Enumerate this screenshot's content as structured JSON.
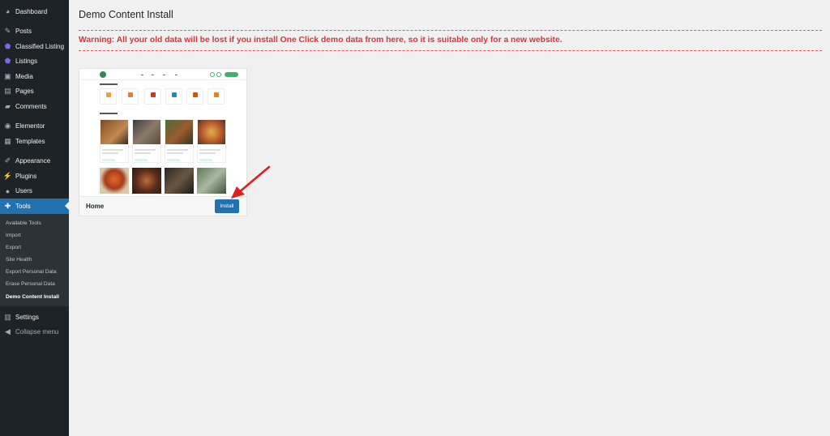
{
  "sidebar": {
    "items": [
      {
        "label": "Dashboard",
        "icon": "dashboard-icon"
      },
      {
        "label": "Posts",
        "icon": "pin-icon"
      },
      {
        "label": "Classified Listing",
        "icon": "shield-icon"
      },
      {
        "label": "Listings",
        "icon": "shield-icon"
      },
      {
        "label": "Media",
        "icon": "media-icon"
      },
      {
        "label": "Pages",
        "icon": "pages-icon"
      },
      {
        "label": "Comments",
        "icon": "comment-icon"
      },
      {
        "label": "Elementor",
        "icon": "elementor-icon"
      },
      {
        "label": "Templates",
        "icon": "templates-icon"
      },
      {
        "label": "Appearance",
        "icon": "brush-icon"
      },
      {
        "label": "Plugins",
        "icon": "plugin-icon"
      },
      {
        "label": "Users",
        "icon": "user-icon"
      },
      {
        "label": "Tools",
        "icon": "wrench-icon"
      }
    ],
    "submenu": [
      "Available Tools",
      "Import",
      "Export",
      "Site Health",
      "Export Personal Data",
      "Erase Personal Data",
      "Demo Content Install"
    ],
    "settings_label": "Settings",
    "collapse_label": "Collapse menu"
  },
  "page": {
    "title": "Demo Content Install",
    "warning": "Warning: All your old data will be lost if you install One Click demo data from here, so it is suitable only for a new website."
  },
  "demo": {
    "name": "Home",
    "install_label": "Install"
  },
  "colors": {
    "sidebar_bg": "#1d2327",
    "accent": "#2271b1",
    "warning": "#d63638"
  }
}
